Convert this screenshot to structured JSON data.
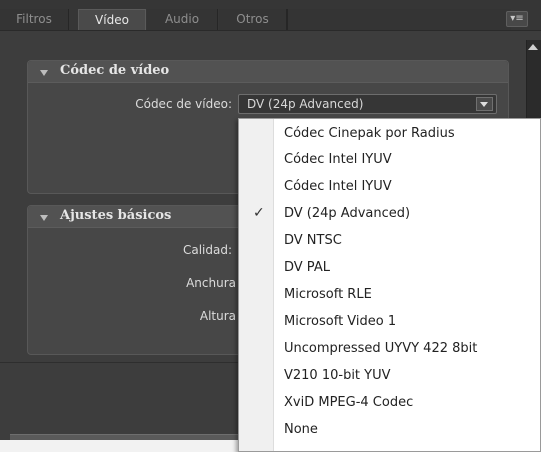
{
  "tabs": [
    {
      "label": "Filtros",
      "active": false
    },
    {
      "label": "Vídeo",
      "active": true
    },
    {
      "label": "Audio",
      "active": false
    },
    {
      "label": "Otros",
      "active": false
    }
  ],
  "panel_menu_icon": "panel-menu-icon",
  "sections": {
    "codec": {
      "title": "Códec de vídeo",
      "field_label": "Códec de vídeo:",
      "selected_value": "DV (24p Advanced)"
    },
    "basic": {
      "title": "Ajustes básicos",
      "labels": [
        "Calidad:",
        "Anchura",
        "Altura"
      ]
    }
  },
  "dropdown": {
    "items": [
      {
        "label": "Códec Cinepak por Radius",
        "checked": false
      },
      {
        "label": "Códec Intel IYUV",
        "checked": false
      },
      {
        "label": "Códec Intel IYUV",
        "checked": false
      },
      {
        "label": "DV (24p Advanced)",
        "checked": true
      },
      {
        "label": "DV NTSC",
        "checked": false
      },
      {
        "label": "DV PAL",
        "checked": false
      },
      {
        "label": "Microsoft RLE",
        "checked": false
      },
      {
        "label": "Microsoft Video 1",
        "checked": false
      },
      {
        "label": "Uncompressed UYVY 422 8bit",
        "checked": false
      },
      {
        "label": "V210 10-bit YUV",
        "checked": false
      },
      {
        "label": "XviD MPEG-4 Codec",
        "checked": false
      },
      {
        "label": "None",
        "checked": false
      }
    ],
    "check_glyph": "✓"
  },
  "colors": {
    "panel_bg": "#3d3d3d",
    "dropdown_bg": "#ffffff",
    "text_light": "#dcdcdc"
  }
}
